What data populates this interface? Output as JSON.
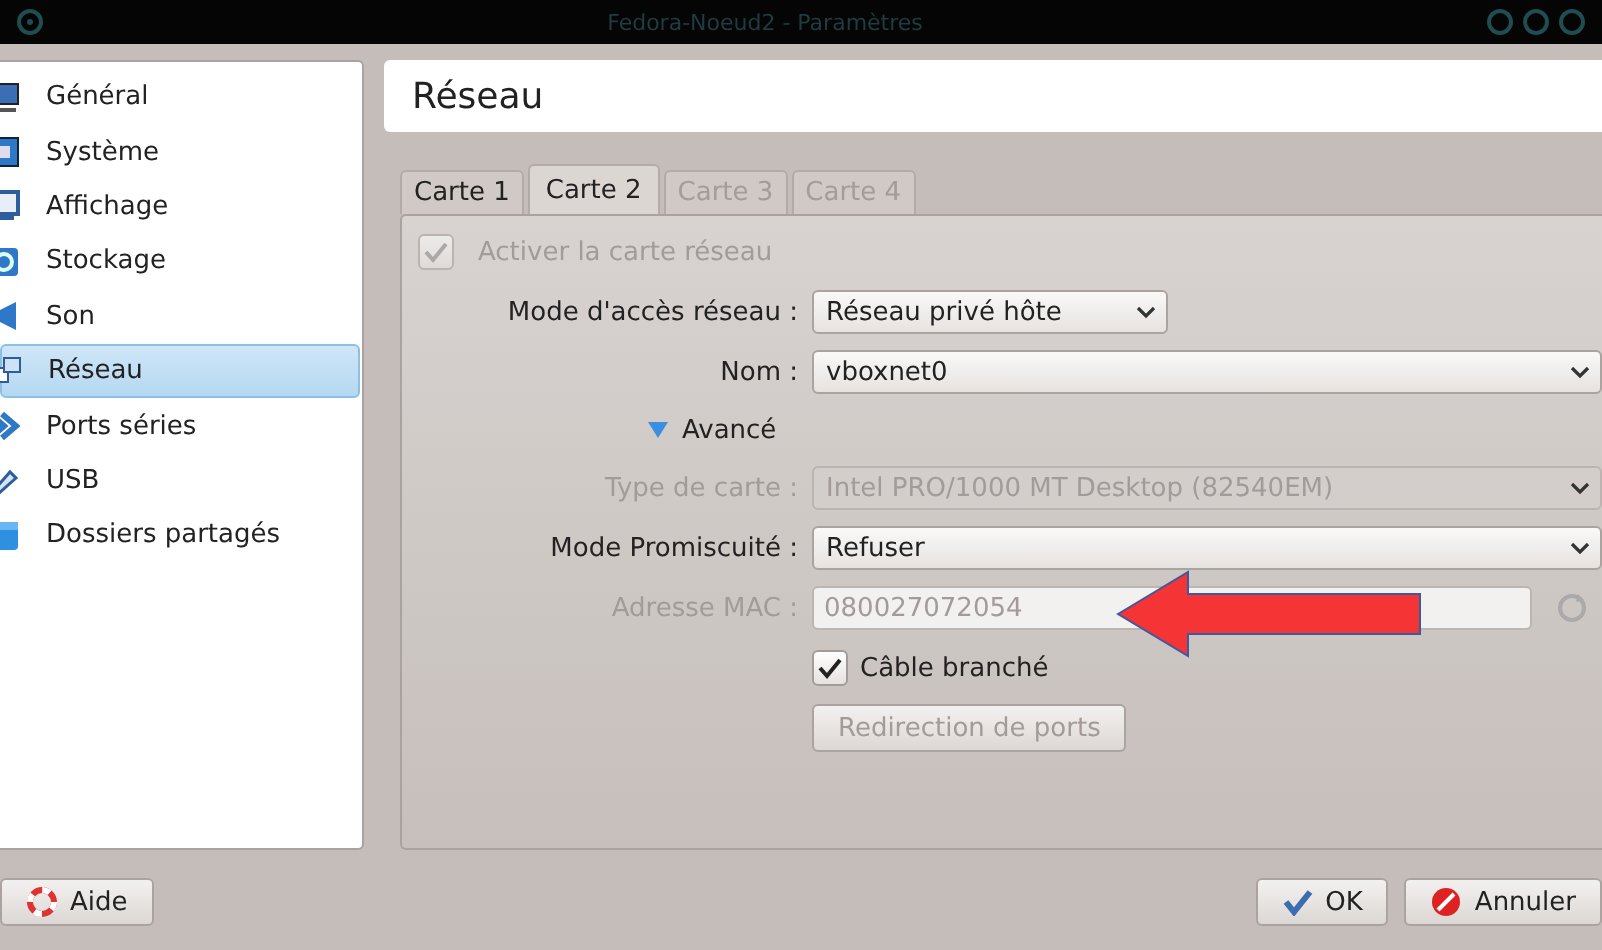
{
  "window": {
    "title": "Fedora-Noeud2 - Paramètres"
  },
  "sidebar": {
    "items": [
      {
        "label": "Général",
        "kind": "monitor",
        "selected": false
      },
      {
        "label": "Système",
        "kind": "chip",
        "selected": false
      },
      {
        "label": "Affichage",
        "kind": "display",
        "selected": false
      },
      {
        "label": "Stockage",
        "kind": "disk",
        "selected": false
      },
      {
        "label": "Son",
        "kind": "speaker",
        "selected": false
      },
      {
        "label": "Réseau",
        "kind": "network",
        "selected": true
      },
      {
        "label": "Ports séries",
        "kind": "serial",
        "selected": false
      },
      {
        "label": "USB",
        "kind": "usb",
        "selected": false
      },
      {
        "label": "Dossiers partagés",
        "kind": "folder",
        "selected": false
      }
    ]
  },
  "page_title": "Réseau",
  "tabs": [
    {
      "label": "Carte 1",
      "selected": false,
      "disabled": false
    },
    {
      "label": "Carte 2",
      "selected": true,
      "disabled": false
    },
    {
      "label": "Carte 3",
      "selected": false,
      "disabled": true
    },
    {
      "label": "Carte 4",
      "selected": false,
      "disabled": true
    }
  ],
  "form": {
    "enable": {
      "label": "Activer la carte réseau",
      "checked": true,
      "disabled": true
    },
    "rows": [
      {
        "kind": "compact-select",
        "label": "Mode d'accès réseau :",
        "value": "Réseau privé hôte",
        "disabled": false
      },
      {
        "kind": "select",
        "label": "Nom :",
        "value": "vboxnet0",
        "disabled": false
      },
      {
        "kind": "expander",
        "label": "Avancé",
        "expanded": true
      },
      {
        "kind": "select",
        "label": "Type de carte :",
        "value": "Intel PRO/1000 MT Desktop (82540EM)",
        "disabled": true
      },
      {
        "kind": "select",
        "label": "Mode Promiscuité :",
        "value": "Refuser",
        "disabled": false
      },
      {
        "kind": "text",
        "label": "Adresse MAC :",
        "value": "080027072054",
        "disabled": true
      },
      {
        "kind": "checkbox",
        "label": "Câble branché",
        "checked": true,
        "disabled": false
      },
      {
        "kind": "button",
        "label": "Redirection de ports",
        "disabled": true
      }
    ]
  },
  "buttons": {
    "help": "Aide",
    "ok": "OK",
    "cancel": "Annuler"
  }
}
